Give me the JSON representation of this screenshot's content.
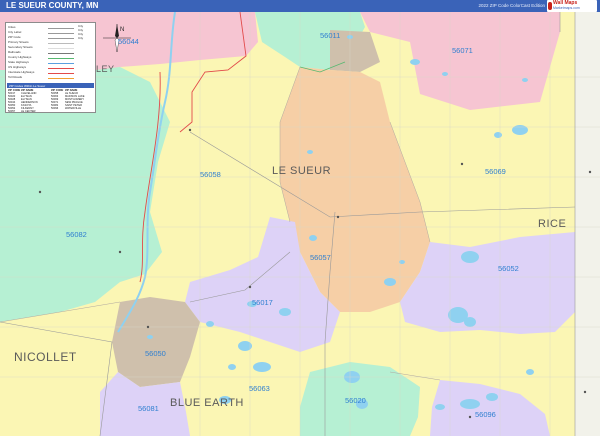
{
  "header": {
    "title": "LE SUEUR COUNTY, MN",
    "edition": "2022 ZIP Code ColorCast Edition",
    "brand_main": "Wall Maps",
    "brand_sub": "Marketmaps.com"
  },
  "colors": {
    "title_bar": "#3a63b8",
    "zip_text": "#2f7fd0",
    "county_text": "#5a5a5a",
    "yellow": "#fbf6b4",
    "orange": "#f6cfa6",
    "green": "#b6f0d3",
    "purple": "#ddd2f7",
    "tan": "#cfc0ac",
    "pink": "#f6c5d2",
    "water": "#8fd1f0"
  },
  "compass": {
    "text": "N"
  },
  "legend": {
    "items": [
      "Cities",
      "City Label",
      "ZIP Code",
      "Primary Streets",
      "Secondary Streets",
      "Railroads",
      "County Highways",
      "State Highways",
      "US Highways",
      "Interstate Highways",
      "Toll Roads"
    ],
    "scale_labels": [
      "City",
      "City",
      "City",
      "City"
    ],
    "table_title": "ZIP Codes Within Le Sueur",
    "table_rows": [
      [
        "ZIP CODE",
        "ZIP NAME",
        "ZIP CODE",
        "ZIP NAME"
      ],
      [
        "56017",
        "CLEVELAND",
        "56058",
        "LE SUEUR"
      ],
      [
        "56020",
        "ELYSIAN",
        "56063",
        "MADISON LAKE"
      ],
      [
        "56028",
        "ELYSIAN",
        "56069",
        "MONTGOMERY"
      ],
      [
        "56044",
        "HENDERSON",
        "56071",
        "NEW PRAGUE"
      ],
      [
        "56050",
        "KASOTA",
        "56082",
        "SAINT PETER"
      ],
      [
        "56052",
        "KILKENNY",
        "56096",
        "WATERVILLE"
      ],
      [
        "56057",
        "LE CENTER",
        "",
        ""
      ]
    ]
  },
  "map": {
    "zip_labels": [
      {
        "code": "56044"
      },
      {
        "code": "56011"
      },
      {
        "code": "56071"
      },
      {
        "code": "56058"
      },
      {
        "code": "56069"
      },
      {
        "code": "56082"
      },
      {
        "code": "56057"
      },
      {
        "code": "56052"
      },
      {
        "code": "56017"
      },
      {
        "code": "56050"
      },
      {
        "code": "56063"
      },
      {
        "code": "56020"
      },
      {
        "code": "56081"
      },
      {
        "code": "56096"
      }
    ],
    "county_labels": [
      "LE SUEUR",
      "RICE",
      "NICOLLET",
      "BLUE EARTH",
      "LEY"
    ]
  }
}
